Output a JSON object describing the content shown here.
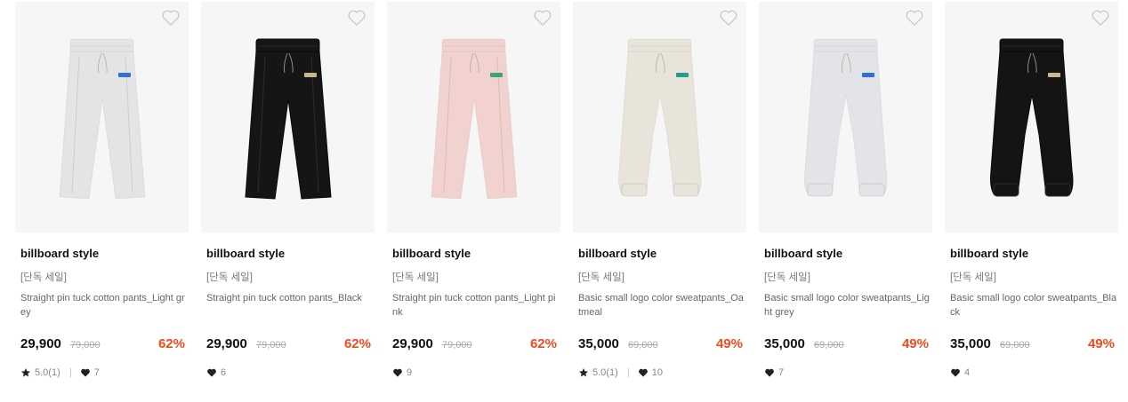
{
  "products": [
    {
      "brand": "billboard style",
      "tag": "[단독 세일]",
      "name": "Straight pin tuck cotton pants_Light grey",
      "price": "29,900",
      "original_price": "79,000",
      "discount": "62%",
      "rating": "5.0(1)",
      "likes": "7",
      "color": "#e4e4e6",
      "logo_color": "#2f6fd6",
      "style": "straight"
    },
    {
      "brand": "billboard style",
      "tag": "[단독 세일]",
      "name": "Straight pin tuck cotton pants_Black",
      "price": "29,900",
      "original_price": "79,000",
      "discount": "62%",
      "likes": "6",
      "color": "#151515",
      "logo_color": "#c9b98a",
      "style": "straight"
    },
    {
      "brand": "billboard style",
      "tag": "[단독 세일]",
      "name": "Straight pin tuck cotton pants_Light pink",
      "price": "29,900",
      "original_price": "79,000",
      "discount": "62%",
      "likes": "9",
      "color": "#f2d2cf",
      "logo_color": "#3aa37a",
      "style": "straight"
    },
    {
      "brand": "billboard style",
      "tag": "[단독 세일]",
      "name": "Basic small logo color sweatpants_Oatmeal",
      "price": "35,000",
      "original_price": "69,000",
      "discount": "49%",
      "rating": "5.0(1)",
      "likes": "10",
      "color": "#e8e4da",
      "logo_color": "#2a9a8e",
      "style": "jogger"
    },
    {
      "brand": "billboard style",
      "tag": "[단독 세일]",
      "name": "Basic small logo color sweatpants_Light grey",
      "price": "35,000",
      "original_price": "69,000",
      "discount": "49%",
      "likes": "7",
      "color": "#e3e4e8",
      "logo_color": "#2f6fd6",
      "style": "jogger"
    },
    {
      "brand": "billboard style",
      "tag": "[단독 세일]",
      "name": "Basic small logo color sweatpants_Black",
      "price": "35,000",
      "original_price": "69,000",
      "discount": "49%",
      "likes": "4",
      "color": "#141414",
      "logo_color": "#c9b98a",
      "style": "jogger"
    }
  ]
}
